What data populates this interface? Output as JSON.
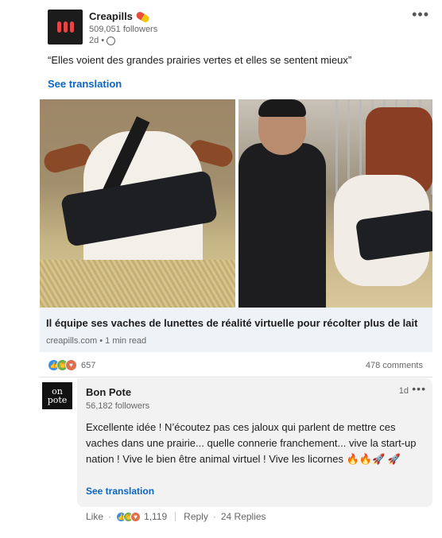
{
  "post": {
    "author": "Creapills",
    "followers": "509,051 followers",
    "time": "2d",
    "text": "“Elles voient des grandes prairies vertes et elles se sentent mieux”",
    "see_translation": "See translation",
    "more_icon": "•••"
  },
  "article": {
    "headline": "Il équipe ses vaches de lunettes de réalité virtuelle pour récolter plus de lait",
    "source": "creapills.com • 1 min read"
  },
  "stats": {
    "reactions": "657",
    "comments": "478 comments"
  },
  "comment": {
    "author": "Bon Pote",
    "avatar_text_1": "on",
    "avatar_text_2": "pote",
    "followers": "56,182 followers",
    "time": "1d",
    "more_icon": "•••",
    "text": "Excellente idée ! N’écoutez pas ces jaloux qui parlent de mettre ces vaches dans une prairie... quelle connerie franchement... vive la start-up nation ! Vive le bien être animal virtuel ! Vive les licornes 🔥🔥🚀 🚀",
    "see_translation": "See translation",
    "like": "Like",
    "reaction_count": "1,119",
    "reply": "Reply",
    "replies": "24 Replies"
  },
  "icons": {
    "reaction_like": "like-icon",
    "reaction_clap": "celebrate-icon",
    "reaction_heart": "love-icon",
    "globe": "globe-icon",
    "pill": "pill-icon"
  }
}
